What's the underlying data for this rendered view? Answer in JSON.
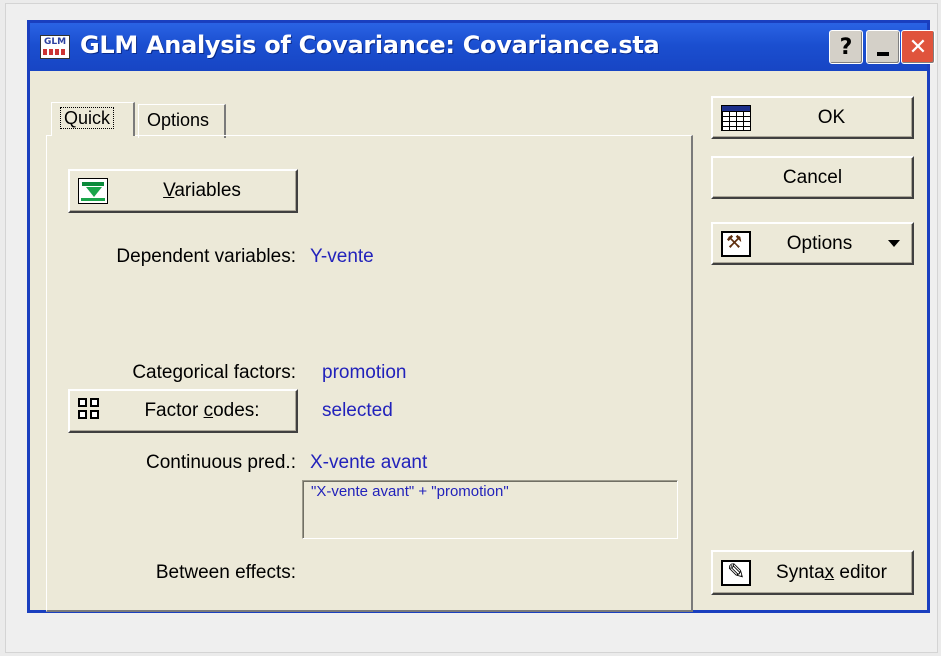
{
  "window": {
    "title": "GLM Analysis of Covariance: Covariance.sta",
    "app_icon_text": "GLM",
    "help_label": "?"
  },
  "tabs": [
    {
      "label": "Quick",
      "active": true
    },
    {
      "label": "Options",
      "active": false
    }
  ],
  "quick": {
    "variables_button": {
      "mnemonic": "V",
      "rest": "ariables"
    },
    "dependent_label": "Dependent variables:",
    "dependent_value": "Y-vente",
    "categorical_label": "Categorical factors:",
    "categorical_value": "promotion",
    "factor_codes_button": {
      "pre": "Factor ",
      "mnemonic": "c",
      "rest": "odes:"
    },
    "factor_codes_value": "selected",
    "continuous_label": "Continuous pred.:",
    "continuous_value": "X-vente avant",
    "between_label": "Between effects:",
    "between_value": "\"X-vente avant\" + \"promotion\""
  },
  "side_buttons": {
    "ok": "OK",
    "cancel": "Cancel",
    "options": "Options",
    "syntax": {
      "pre": "Synta",
      "mnemonic": "x",
      "rest": " editor"
    }
  },
  "colors": {
    "value_text": "#2222bb",
    "title_bar": "#1b4fd0",
    "dialog_bg": "#ece9d8"
  }
}
